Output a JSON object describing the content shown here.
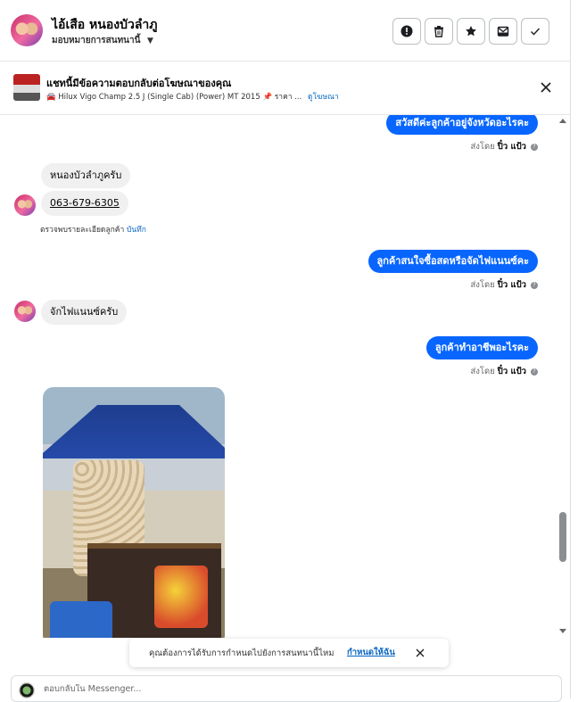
{
  "header": {
    "contact_name": "ไอ้เสือ หนองบัวลำภู",
    "assign_label": "มอบหมายการสนทนานี้",
    "actions": [
      "alert-icon",
      "trash-icon",
      "star-icon",
      "mark-unread-icon",
      "check-icon"
    ]
  },
  "ad_banner": {
    "title": "แชทนี้มีข้อความตอบกลับต่อโฆษณาของคุณ",
    "subtitle": "🚘 Hilux Vigo Champ 2.5 J (Single Cab) (Power) MT 2015 📌 ราคา ...",
    "link": "ดูโฆษณา"
  },
  "messages": {
    "out1": "สวัสดีค่ะลูกค้าอยู่จังหวัดอะไรคะ",
    "out1_sent": {
      "prefix": "ส่งโดย",
      "who": "ปิ๋ว แป้ว"
    },
    "in1": "หนองบัวลำภูครับ",
    "in2": "063-679-6305",
    "review_text": "ตรวจพบรายละเอียดลูกค้า",
    "review_link": "บันทึก",
    "out2": "ลูกค้าสนใจซื้อสดหรือจัดไฟแนนซ์คะ",
    "out2_sent": {
      "prefix": "ส่งโดย",
      "who": "ปิ๋ว แป้ว"
    },
    "in3": "จักไฟแนนซ์ครับ",
    "out3": "ลูกค้าทำอาชีพอะไรคะ",
    "out3_sent": {
      "prefix": "ส่งโดย",
      "who": "ปิ๋ว แป้ว"
    }
  },
  "toast": {
    "text": "คุณต้องการได้รับการกำหนดไปยังการสนทนานี้ไหม",
    "link": "กำหนดให้ฉัน"
  },
  "reply": {
    "placeholder": "ตอบกลับใน Messenger..."
  },
  "colors": {
    "outgoing_bubble": "#0866ff",
    "incoming_bubble": "#f0f0f0",
    "link": "#0a66c2"
  }
}
